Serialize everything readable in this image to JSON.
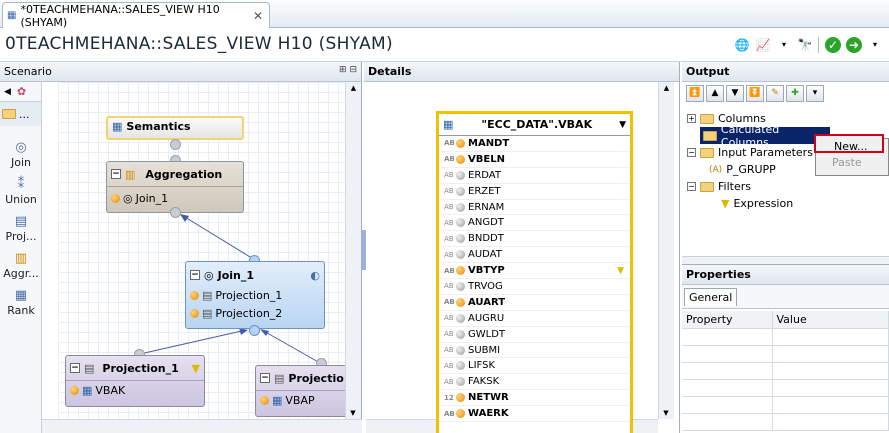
{
  "tab": {
    "title": "*0TEACHMEHANA::SALES_VIEW H10 (SHYAM)",
    "close": "✕"
  },
  "editor_title": "0TEACHMEHANA::SALES_VIEW H10 (SHYAM)",
  "scenario": {
    "header": "Scenario",
    "palette_folder": "...",
    "palette": [
      "Join",
      "Union",
      "Proj...",
      "Aggr...",
      "Rank"
    ]
  },
  "nodes": {
    "semantics": "Semantics",
    "aggregation": {
      "title": "Aggregation",
      "input": "Join_1"
    },
    "join": {
      "title": "Join_1",
      "inputs": [
        "Projection_1",
        "Projection_2"
      ]
    },
    "projection1": {
      "title": "Projection_1",
      "input": "VBAK"
    },
    "projection2": {
      "title": "Projectio",
      "input": "VBAP"
    }
  },
  "details": {
    "header": "Details",
    "table_title": "\"ECC_DATA\".VBAK",
    "columns": [
      {
        "name": "MANDT",
        "type": "AB",
        "key": true
      },
      {
        "name": "VBELN",
        "type": "AB",
        "key": true
      },
      {
        "name": "ERDAT",
        "type": "AB",
        "key": false
      },
      {
        "name": "ERZET",
        "type": "AB",
        "key": false
      },
      {
        "name": "ERNAM",
        "type": "AB",
        "key": false
      },
      {
        "name": "ANGDT",
        "type": "AB",
        "key": false
      },
      {
        "name": "BNDDT",
        "type": "AB",
        "key": false
      },
      {
        "name": "AUDAT",
        "type": "AB",
        "key": false
      },
      {
        "name": "VBTYP",
        "type": "AB",
        "key": true,
        "filter": true
      },
      {
        "name": "TRVOG",
        "type": "AB",
        "key": false
      },
      {
        "name": "AUART",
        "type": "AB",
        "key": true
      },
      {
        "name": "AUGRU",
        "type": "AB",
        "key": false
      },
      {
        "name": "GWLDT",
        "type": "AB",
        "key": false
      },
      {
        "name": "SUBMI",
        "type": "AB",
        "key": false
      },
      {
        "name": "LIFSK",
        "type": "AB",
        "key": false
      },
      {
        "name": "FAKSK",
        "type": "AB",
        "key": false
      },
      {
        "name": "NETWR",
        "type": "12",
        "key": true
      },
      {
        "name": "WAERK",
        "type": "AB",
        "key": true
      }
    ]
  },
  "output": {
    "header": "Output",
    "tree": {
      "columns": "Columns",
      "calculated_columns": "Calculated Columns",
      "input_parameters": "Input Parameters",
      "param": "P_GRUPP",
      "filters": "Filters",
      "expression": "Expression"
    },
    "context_menu": {
      "new": "New...",
      "paste": "Paste"
    }
  },
  "properties": {
    "header": "Properties",
    "tab": "General",
    "col_property": "Property",
    "col_value": "Value"
  },
  "colors": {
    "selected": "#0a246a",
    "highlight_box": "#d0021b",
    "table_border": "#f2c200"
  }
}
